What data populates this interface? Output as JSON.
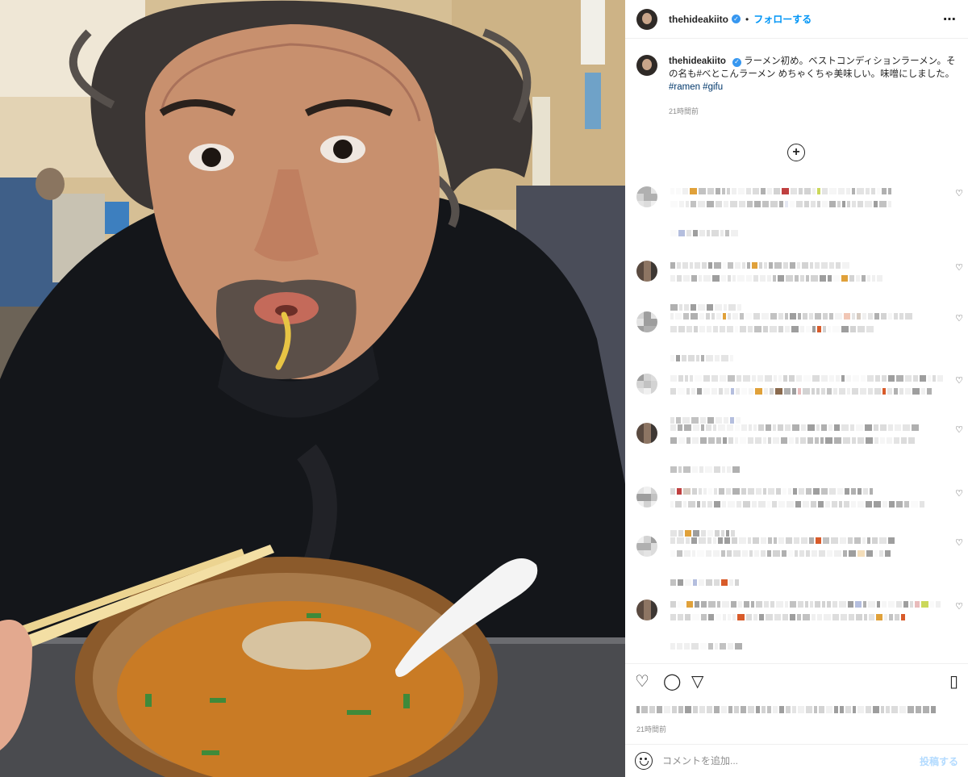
{
  "header": {
    "username": "thehideakiito",
    "separator": "•",
    "follow_label": "フォローする",
    "more_label": "⋯"
  },
  "caption": {
    "username": "thehideakiito",
    "text": "ラーメン初め。ベストコンディションラーメン。その名も#べとこんラーメン めちゃくちゃ美味しい。味噌にしました。",
    "hashtags": "#ramen #gifu",
    "time": "21時間前"
  },
  "load_more_label": "+",
  "actions": {
    "like_icon": "♡",
    "comment_icon": "◯",
    "share_icon": "▽",
    "save_icon": "▯"
  },
  "post_time": "21時間前",
  "add_comment": {
    "placeholder": "コメントを追加...",
    "post_label": "投稿する"
  },
  "colors": {
    "link_blue": "#0095f6",
    "verified_blue": "#3797f0",
    "hashtag": "#00376b",
    "muted": "#8e8e8e",
    "post_disabled": "#b3dbff"
  },
  "icons": {
    "verified": "verified-badge-icon",
    "heart": "heart-icon",
    "comment": "comment-icon",
    "share": "share-icon",
    "bookmark": "bookmark-icon",
    "emoji": "emoji-icon",
    "add": "plus-circle-icon"
  }
}
